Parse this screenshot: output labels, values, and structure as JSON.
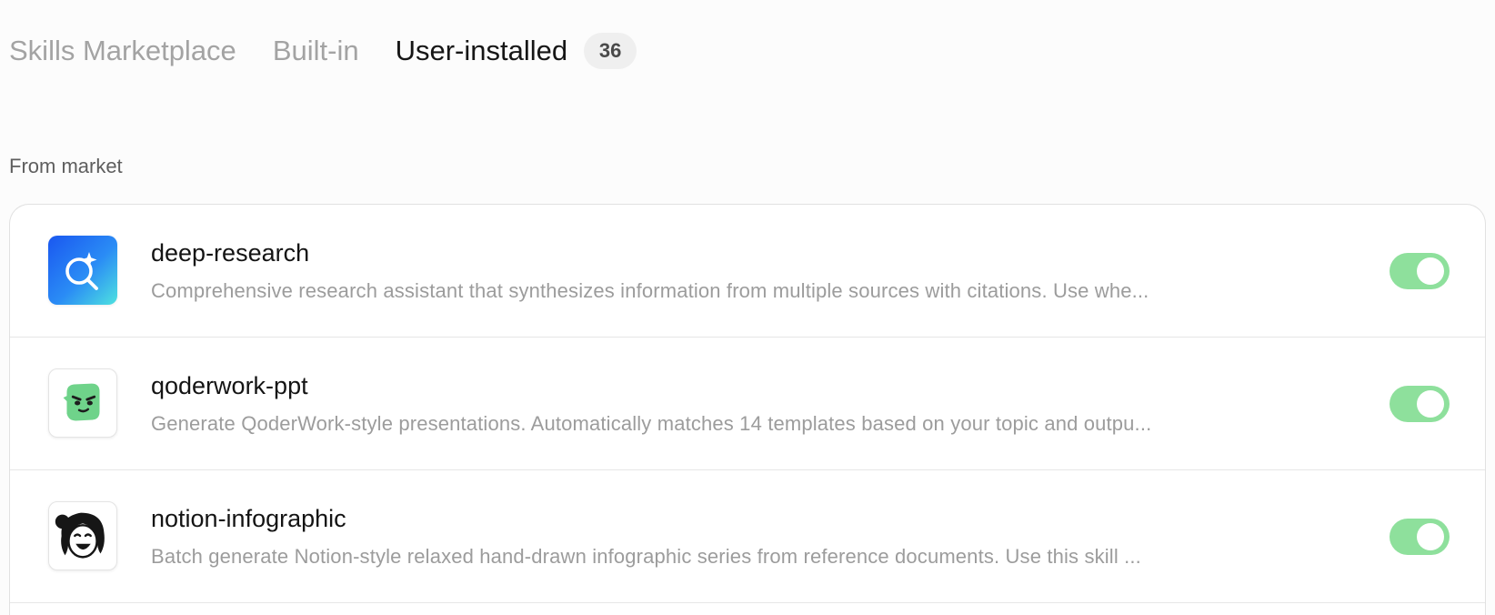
{
  "tabs": [
    {
      "label": "Skills Marketplace"
    },
    {
      "label": "Built-in"
    },
    {
      "label": "User-installed",
      "count": "36"
    }
  ],
  "section_label": "From market",
  "skills": [
    {
      "name": "deep-research",
      "description": "Comprehensive research assistant that synthesizes information from multiple sources with citations. Use whe...",
      "icon": "search-sparkle-icon",
      "enabled": true
    },
    {
      "name": "qoderwork-ppt",
      "description": "Generate QoderWork-style presentations. Automatically matches 14 templates based on your topic and outpu...",
      "icon": "green-mascot-icon",
      "enabled": true
    },
    {
      "name": "notion-infographic",
      "description": "Batch generate Notion-style relaxed hand-drawn infographic series from reference documents. Use this skill ...",
      "icon": "cartoon-face-icon",
      "enabled": true
    }
  ],
  "colors": {
    "toggle_on": "#8ee09c",
    "active_tab": "#161616",
    "inactive_tab": "#a3a3a3"
  }
}
